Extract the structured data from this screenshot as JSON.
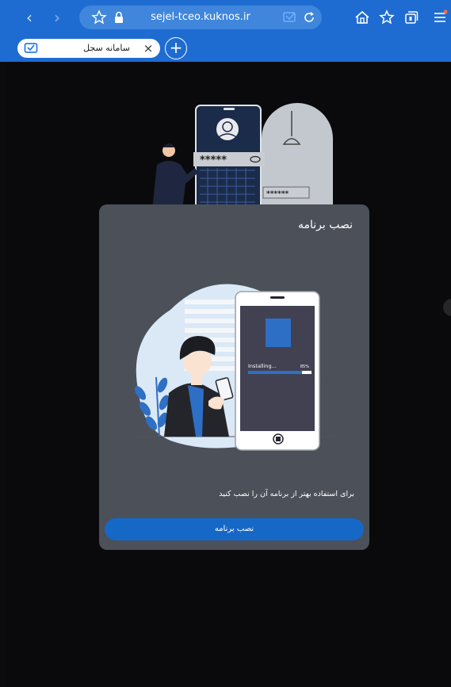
{
  "browser": {
    "url": "sejel-tceo.kuknos.ir",
    "tab_title": "سامانه سجل",
    "tab_close": "×",
    "new_tab": "+",
    "nav_back": "‹",
    "nav_forward": "›",
    "accent": "#1e6cd2"
  },
  "modal": {
    "title": "نصب برنامه",
    "description": "برای استفاده بهتر از برنامه آن را نصب کنید",
    "install_label": "نصب برنامه",
    "illustration": {
      "status_text": "Installing...",
      "percent": "85%",
      "progress": 0.85
    }
  },
  "background_illustration": {
    "password_mask": "*****",
    "pin_mask": "******"
  }
}
